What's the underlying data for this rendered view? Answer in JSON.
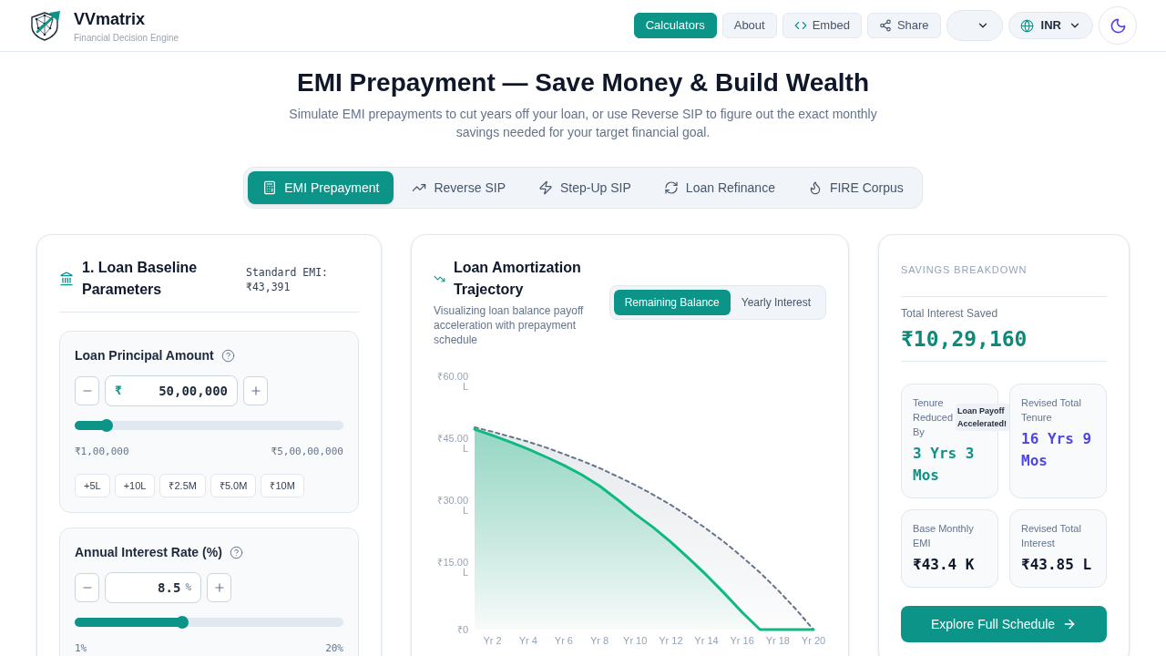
{
  "header": {
    "brand": "VVmatrix",
    "tagline": "Financial Decision Engine",
    "nav": [
      {
        "label": "Calculators",
        "selected": true,
        "kind": "text"
      },
      {
        "label": "About",
        "selected": false,
        "kind": "text"
      },
      {
        "label": "Embed",
        "selected": false,
        "kind": "code"
      },
      {
        "label": "Share",
        "selected": false,
        "kind": "share"
      }
    ],
    "currency": "INR"
  },
  "hero": {
    "title": "EMI Prepayment — Save Money & Build Wealth",
    "subtitle": "Simulate EMI prepayments to cut years off your loan, or use Reverse SIP to figure out the exact monthly savings needed for your target financial goal."
  },
  "tabs": [
    {
      "label": "EMI Prepayment",
      "selected": true,
      "kind": "calculator"
    },
    {
      "label": "Reverse SIP",
      "selected": false,
      "kind": "trend"
    },
    {
      "label": "Step-Up SIP",
      "selected": false,
      "kind": "bolt"
    },
    {
      "label": "Loan Refinance",
      "selected": false,
      "kind": "refresh"
    },
    {
      "label": "FIRE Corpus",
      "selected": false,
      "kind": "flame"
    }
  ],
  "loan_panel": {
    "title": "1. Loan Baseline Parameters",
    "standard_emi": "Standard EMI: ₹43,391",
    "fields": [
      {
        "label": "Loan Principal Amount",
        "prefix": "₹",
        "value": "50,00,000",
        "level": 0.1,
        "min": "₹1,00,000",
        "max": "₹5,00,00,000",
        "presets": [
          "+5L",
          "+10L",
          "₹2.5M",
          "₹5.0M",
          "₹10M"
        ]
      },
      {
        "label": "Annual Interest Rate (%)",
        "value": "8.5",
        "suffix": "%",
        "level": 0.395,
        "min": "1%",
        "max": "20%"
      }
    ]
  },
  "chart_panel": {
    "title": "Loan Amortization Trajectory",
    "description": "Visualizing loan balance payoff acceleration with prepayment schedule",
    "views": [
      {
        "label": "Remaining Balance",
        "selected": true
      },
      {
        "label": "Yearly Interest",
        "selected": false
      }
    ],
    "chart_data": {
      "type": "area",
      "categories": [
        null,
        "Yr 2",
        null,
        "Yr 4",
        null,
        "Yr 6",
        null,
        "Yr 8",
        null,
        "Yr 10",
        null,
        "Yr 12",
        null,
        "Yr 14",
        null,
        "Yr 16",
        null,
        "Yr 18",
        null,
        "Yr 20"
      ],
      "ylim": [
        0,
        60
      ],
      "yticks": [
        {
          "value": 0,
          "label": "₹0"
        },
        {
          "value": 15,
          "label": "₹15.00 L"
        },
        {
          "value": 30,
          "label": "₹30.00 L"
        },
        {
          "value": 45,
          "label": "₹45.00 L"
        },
        {
          "value": 60,
          "label": "₹60.00 L"
        }
      ],
      "series": [
        {
          "color": "#10b981",
          "values": [
            48.5,
            47.0,
            45.4,
            43.7,
            41.8,
            39.8,
            37.5,
            34.8,
            31.5,
            28.0,
            24.8,
            21.2,
            17.3,
            13.2,
            8.8,
            4.2,
            0,
            0,
            0,
            0
          ]
        },
        {
          "color": "#64748b",
          "values": [
            49.0,
            47.9,
            46.7,
            45.5,
            44.1,
            42.5,
            40.9,
            39.1,
            37.1,
            35.0,
            32.7,
            30.2,
            27.4,
            24.4,
            21.2,
            17.6,
            13.8,
            9.6,
            5.0,
            0
          ]
        }
      ]
    }
  },
  "savings": {
    "heading": "SAVINGS BREAKDOWN",
    "total_label": "Total Interest Saved",
    "total_value": "₹10,29,160",
    "stats": [
      {
        "label": "Tenure Reduced By",
        "value": "3 Yrs 3 Mos",
        "color": "#0d9488",
        "badge": "Loan Payoff Accelerated!"
      },
      {
        "label": "Revised Total Tenure",
        "value": "16 Yrs 9 Mos",
        "color": "#4f46e5"
      },
      {
        "label": "Base Monthly EMI",
        "value": "₹43.4 K",
        "color": "#0f172a"
      },
      {
        "label": "Revised Total Interest",
        "value": "₹43.85 L",
        "color": "#0f172a"
      }
    ],
    "button": "Explore Full Schedule"
  }
}
